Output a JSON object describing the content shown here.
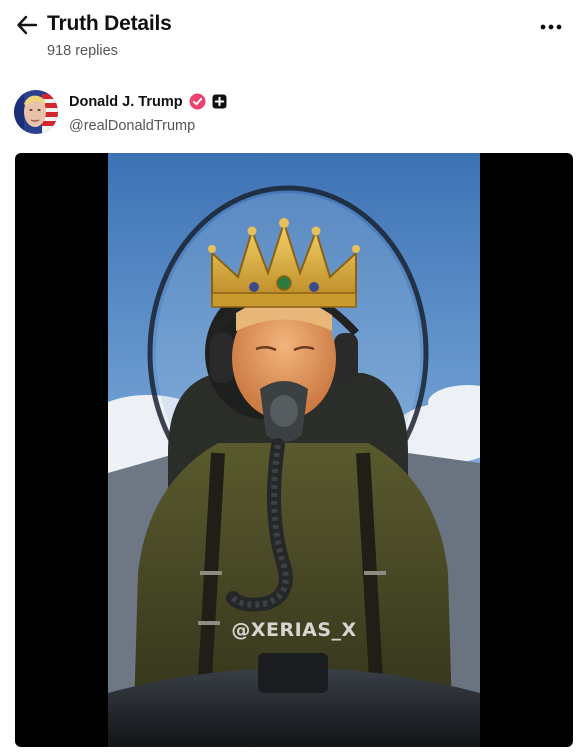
{
  "header": {
    "title": "Truth Details",
    "replies": "918 replies",
    "back_icon": "arrow-left-icon",
    "more_icon": "more-horizontal-icon"
  },
  "post": {
    "author_name": "Donald J. Trump",
    "author_handle": "@realDonaldTrump",
    "verified_icon": "verified-badge-icon",
    "verified_color": "#e8446d",
    "plus_icon": "plus-square-icon",
    "media": {
      "watermark": "@XERIAS_X"
    }
  }
}
